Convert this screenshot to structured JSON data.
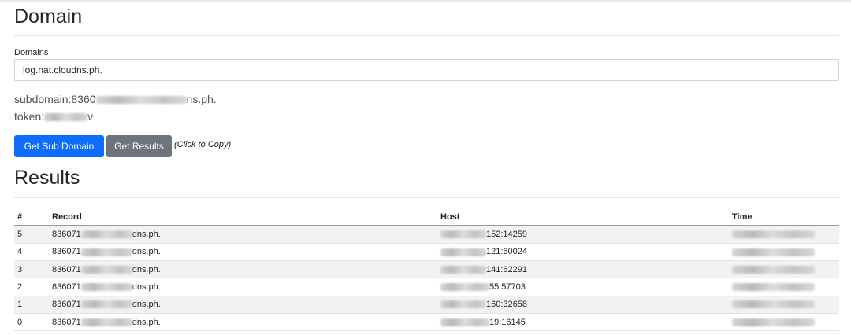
{
  "domain_section": {
    "title": "Domain",
    "field_label": "Domains",
    "field_value": "log.nat.cloudns.ph.",
    "subdomain_prefix": "subdomain:8360",
    "subdomain_suffix": "ns.ph.",
    "token_prefix": "token:",
    "token_suffix": "v"
  },
  "buttons": {
    "get_sub_domain": "Get Sub Domain",
    "get_results": "Get Results",
    "hint": "(Click to Copy)"
  },
  "colors": {
    "primary": "#0d6efd",
    "secondary": "#6c757d"
  },
  "results_section": {
    "title": "Results",
    "columns": [
      "#",
      "Record",
      "Host",
      "Time"
    ],
    "rows": [
      {
        "id": "5",
        "record_prefix": "836071",
        "record_suffix": "dns.ph.",
        "host_suffix": "152:14259"
      },
      {
        "id": "4",
        "record_prefix": "836071",
        "record_suffix": "dns.ph.",
        "host_suffix": "121:60024"
      },
      {
        "id": "3",
        "record_prefix": "836071",
        "record_suffix": "dns.ph.",
        "host_suffix": "141:62291"
      },
      {
        "id": "2",
        "record_prefix": "836071",
        "record_suffix": "dns.ph.",
        "host_suffix": "55:57703"
      },
      {
        "id": "1",
        "record_prefix": "836071",
        "record_suffix": "dns.ph.",
        "host_suffix": "160:32658"
      },
      {
        "id": "0",
        "record_prefix": "836071",
        "record_suffix": "dns.ph.",
        "host_suffix": "19:16145"
      }
    ]
  }
}
